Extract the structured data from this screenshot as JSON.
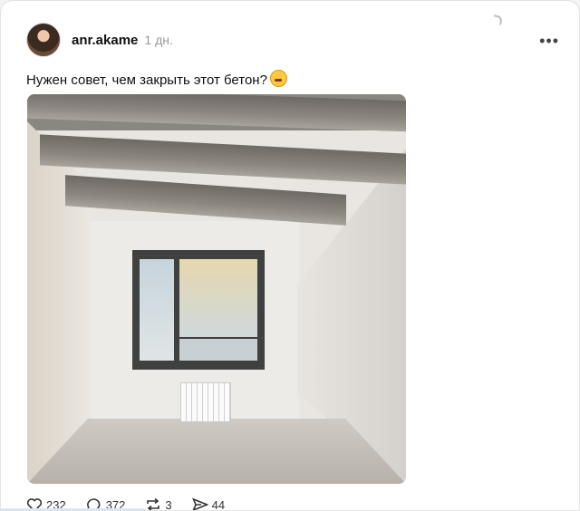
{
  "post": {
    "username": "anr.akame",
    "time": "1 дн.",
    "text": "Нужен совет, чем закрыть этот бетон?",
    "emoji": "face-with-hand-over-mouth",
    "more_label": "•••"
  },
  "actions": {
    "likes": "232",
    "comments": "372",
    "reposts": "3",
    "shares": "44"
  }
}
